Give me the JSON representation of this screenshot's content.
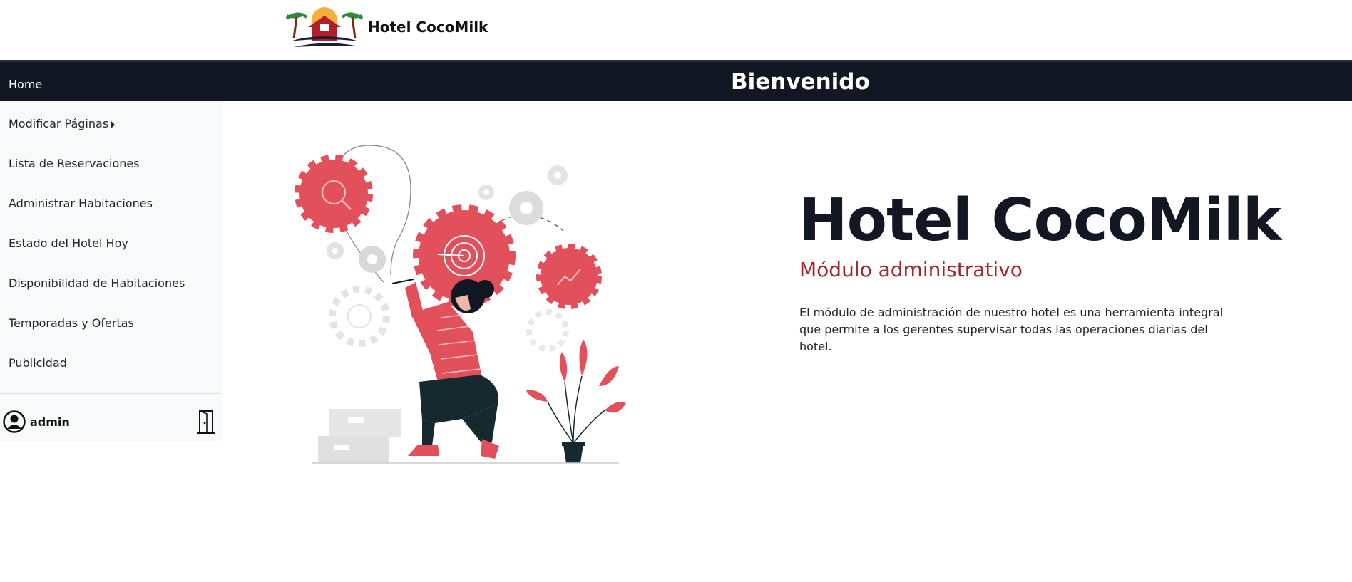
{
  "brand": {
    "name": "Hotel CocoMilk"
  },
  "topbar": {
    "home_label": "Home",
    "welcome": "Bienvenido"
  },
  "sidebar": {
    "items": [
      {
        "label": "Modificar Páginas"
      },
      {
        "label": "Lista de Reservaciones"
      },
      {
        "label": "Administrar Habitaciones"
      },
      {
        "label": "Estado del Hotel Hoy"
      },
      {
        "label": "Disponibilidad de Habitaciones"
      },
      {
        "label": "Temporadas y Ofertas"
      },
      {
        "label": "Publicidad"
      }
    ],
    "user": {
      "name": "admin"
    }
  },
  "main": {
    "title": "Hotel CocoMilk",
    "subtitle": "Módulo administrativo",
    "description": "El módulo de administración de nuestro hotel es una herramienta integral que permite a los gerentes supervisar todas las operaciones diarias del hotel."
  },
  "colors": {
    "dark": "#121823",
    "accent": "#e2505c",
    "subtitle": "#a4262c",
    "sidebar_bg": "#f8f9fa"
  },
  "icons": {
    "logo": "hotel-logo",
    "user": "user-circle-icon",
    "logout": "door-icon"
  }
}
